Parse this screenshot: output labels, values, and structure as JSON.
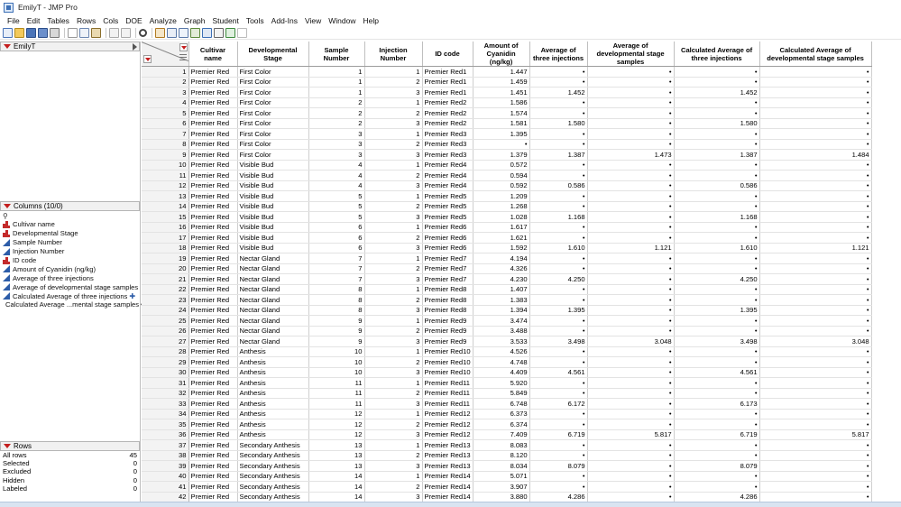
{
  "window": {
    "title": "EmilyT - JMP Pro"
  },
  "menu": [
    "File",
    "Edit",
    "Tables",
    "Rows",
    "Cols",
    "DOE",
    "Analyze",
    "Graph",
    "Student",
    "Tools",
    "Add-Ins",
    "View",
    "Window",
    "Help"
  ],
  "table_panel": {
    "name": "EmilyT"
  },
  "columns_panel": {
    "header": "Columns (10/0)",
    "items": [
      {
        "label": "Cultivar name",
        "type": "nominal"
      },
      {
        "label": "Developmental Stage",
        "type": "nominal"
      },
      {
        "label": "Sample Number",
        "type": "continuous"
      },
      {
        "label": "Injection Number",
        "type": "continuous"
      },
      {
        "label": "ID code",
        "type": "nominal"
      },
      {
        "label": "Amount of Cyanidin (ng/kg)",
        "type": "continuous"
      },
      {
        "label": "Average of three injections",
        "type": "continuous"
      },
      {
        "label": "Average of developmental stage samples",
        "type": "continuous"
      },
      {
        "label": "Calculated Average of three injections",
        "type": "continuous",
        "badge": "plus"
      },
      {
        "label": "Calculated Average ...mental stage samples",
        "type": "continuous",
        "badge": "dot"
      }
    ]
  },
  "rows_panel": {
    "header": "Rows",
    "items": [
      {
        "label": "All rows",
        "value": "45"
      },
      {
        "label": "Selected",
        "value": "0"
      },
      {
        "label": "Excluded",
        "value": "0"
      },
      {
        "label": "Hidden",
        "value": "0"
      },
      {
        "label": "Labeled",
        "value": "0"
      }
    ]
  },
  "grid": {
    "columns": [
      "Cultivar name",
      "Developmental Stage",
      "Sample Number",
      "Injection Number",
      "ID code",
      "Amount of Cyanidin (ng/kg)",
      "Average of three injections",
      "Average of developmental stage samples",
      "Calculated Average of three injections",
      "Calculated Average of developmental stage samples"
    ],
    "rows": [
      [
        "1",
        "Premier Red",
        "First Color",
        "1",
        "1",
        "Premier Red1",
        "1.447",
        "•",
        "•",
        "•",
        "•"
      ],
      [
        "2",
        "Premier Red",
        "First Color",
        "1",
        "2",
        "Premier Red1",
        "1.459",
        "•",
        "•",
        "•",
        "•"
      ],
      [
        "3",
        "Premier Red",
        "First Color",
        "1",
        "3",
        "Premier Red1",
        "1.451",
        "1.452",
        "•",
        "1.452",
        "•"
      ],
      [
        "4",
        "Premier Red",
        "First Color",
        "2",
        "1",
        "Premier Red2",
        "1.586",
        "•",
        "•",
        "•",
        "•"
      ],
      [
        "5",
        "Premier Red",
        "First Color",
        "2",
        "2",
        "Premier Red2",
        "1.574",
        "•",
        "•",
        "•",
        "•"
      ],
      [
        "6",
        "Premier Red",
        "First Color",
        "2",
        "3",
        "Premier Red2",
        "1.581",
        "1.580",
        "•",
        "1.580",
        "•"
      ],
      [
        "7",
        "Premier Red",
        "First Color",
        "3",
        "1",
        "Premier Red3",
        "1.395",
        "•",
        "•",
        "•",
        "•"
      ],
      [
        "8",
        "Premier Red",
        "First Color",
        "3",
        "2",
        "Premier Red3",
        "•",
        "•",
        "•",
        "•",
        "•"
      ],
      [
        "9",
        "Premier Red",
        "First Color",
        "3",
        "3",
        "Premier Red3",
        "1.379",
        "1.387",
        "1.473",
        "1.387",
        "1.484"
      ],
      [
        "10",
        "Premier Red",
        "Visible Bud",
        "4",
        "1",
        "Premier Red4",
        "0.572",
        "•",
        "•",
        "•",
        "•"
      ],
      [
        "11",
        "Premier Red",
        "Visible Bud",
        "4",
        "2",
        "Premier Red4",
        "0.594",
        "•",
        "•",
        "•",
        "•"
      ],
      [
        "12",
        "Premier Red",
        "Visible Bud",
        "4",
        "3",
        "Premier Red4",
        "0.592",
        "0.586",
        "•",
        "0.586",
        "•"
      ],
      [
        "13",
        "Premier Red",
        "Visible Bud",
        "5",
        "1",
        "Premier Red5",
        "1.209",
        "•",
        "•",
        "•",
        "•"
      ],
      [
        "14",
        "Premier Red",
        "Visible Bud",
        "5",
        "2",
        "Premier Red5",
        "1.268",
        "•",
        "•",
        "•",
        "•"
      ],
      [
        "15",
        "Premier Red",
        "Visible Bud",
        "5",
        "3",
        "Premier Red5",
        "1.028",
        "1.168",
        "•",
        "1.168",
        "•"
      ],
      [
        "16",
        "Premier Red",
        "Visible Bud",
        "6",
        "1",
        "Premier Red6",
        "1.617",
        "•",
        "•",
        "•",
        "•"
      ],
      [
        "17",
        "Premier Red",
        "Visible Bud",
        "6",
        "2",
        "Premier Red6",
        "1.621",
        "•",
        "•",
        "•",
        "•"
      ],
      [
        "18",
        "Premier Red",
        "Visible Bud",
        "6",
        "3",
        "Premier Red6",
        "1.592",
        "1.610",
        "1.121",
        "1.610",
        "1.121"
      ],
      [
        "19",
        "Premier Red",
        "Nectar Gland",
        "7",
        "1",
        "Premier Red7",
        "4.194",
        "•",
        "•",
        "•",
        "•"
      ],
      [
        "20",
        "Premier Red",
        "Nectar Gland",
        "7",
        "2",
        "Premier Red7",
        "4.326",
        "•",
        "•",
        "•",
        "•"
      ],
      [
        "21",
        "Premier Red",
        "Nectar Gland",
        "7",
        "3",
        "Premier Red7",
        "4.230",
        "4.250",
        "•",
        "4.250",
        "•"
      ],
      [
        "22",
        "Premier Red",
        "Nectar Gland",
        "8",
        "1",
        "Premier Red8",
        "1.407",
        "•",
        "•",
        "•",
        "•"
      ],
      [
        "23",
        "Premier Red",
        "Nectar Gland",
        "8",
        "2",
        "Premier Red8",
        "1.383",
        "•",
        "•",
        "•",
        "•"
      ],
      [
        "24",
        "Premier Red",
        "Nectar Gland",
        "8",
        "3",
        "Premier Red8",
        "1.394",
        "1.395",
        "•",
        "1.395",
        "•"
      ],
      [
        "25",
        "Premier Red",
        "Nectar Gland",
        "9",
        "1",
        "Premier Red9",
        "3.474",
        "•",
        "•",
        "•",
        "•"
      ],
      [
        "26",
        "Premier Red",
        "Nectar Gland",
        "9",
        "2",
        "Premier Red9",
        "3.488",
        "•",
        "•",
        "•",
        "•"
      ],
      [
        "27",
        "Premier Red",
        "Nectar Gland",
        "9",
        "3",
        "Premier Red9",
        "3.533",
        "3.498",
        "3.048",
        "3.498",
        "3.048"
      ],
      [
        "28",
        "Premier Red",
        "Anthesis",
        "10",
        "1",
        "Premier Red10",
        "4.526",
        "•",
        "•",
        "•",
        "•"
      ],
      [
        "29",
        "Premier Red",
        "Anthesis",
        "10",
        "2",
        "Premier Red10",
        "4.748",
        "•",
        "•",
        "•",
        "•"
      ],
      [
        "30",
        "Premier Red",
        "Anthesis",
        "10",
        "3",
        "Premier Red10",
        "4.409",
        "4.561",
        "•",
        "4.561",
        "•"
      ],
      [
        "31",
        "Premier Red",
        "Anthesis",
        "11",
        "1",
        "Premier Red11",
        "5.920",
        "•",
        "•",
        "•",
        "•"
      ],
      [
        "32",
        "Premier Red",
        "Anthesis",
        "11",
        "2",
        "Premier Red11",
        "5.849",
        "•",
        "•",
        "•",
        "•"
      ],
      [
        "33",
        "Premier Red",
        "Anthesis",
        "11",
        "3",
        "Premier Red11",
        "6.748",
        "6.172",
        "•",
        "6.173",
        "•"
      ],
      [
        "34",
        "Premier Red",
        "Anthesis",
        "12",
        "1",
        "Premier Red12",
        "6.373",
        "•",
        "•",
        "•",
        "•"
      ],
      [
        "35",
        "Premier Red",
        "Anthesis",
        "12",
        "2",
        "Premier Red12",
        "6.374",
        "•",
        "•",
        "•",
        "•"
      ],
      [
        "36",
        "Premier Red",
        "Anthesis",
        "12",
        "3",
        "Premier Red12",
        "7.409",
        "6.719",
        "5.817",
        "6.719",
        "5.817"
      ],
      [
        "37",
        "Premier Red",
        "Secondary Anthesis",
        "13",
        "1",
        "Premier Red13",
        "8.083",
        "•",
        "•",
        "•",
        "•"
      ],
      [
        "38",
        "Premier Red",
        "Secondary Anthesis",
        "13",
        "2",
        "Premier Red13",
        "8.120",
        "•",
        "•",
        "•",
        "•"
      ],
      [
        "39",
        "Premier Red",
        "Secondary Anthesis",
        "13",
        "3",
        "Premier Red13",
        "8.034",
        "8.079",
        "•",
        "8.079",
        "•"
      ],
      [
        "40",
        "Premier Red",
        "Secondary Anthesis",
        "14",
        "1",
        "Premier Red14",
        "5.071",
        "•",
        "•",
        "•",
        "•"
      ],
      [
        "41",
        "Premier Red",
        "Secondary Anthesis",
        "14",
        "2",
        "Premier Red14",
        "3.907",
        "•",
        "•",
        "•",
        "•"
      ],
      [
        "42",
        "Premier Red",
        "Secondary Anthesis",
        "14",
        "3",
        "Premier Red14",
        "3.880",
        "4.286",
        "•",
        "4.286",
        "•"
      ]
    ]
  },
  "colors": {
    "accent_red": "#c41e1e",
    "continuous_blue": "#2c5ca8"
  },
  "toolbar_icons": [
    "new-table-icon",
    "open-icon",
    "save-icon",
    "save-all-icon",
    "print-icon",
    "cut-icon",
    "copy-icon",
    "paste-icon",
    "undo-icon",
    "redo-icon",
    "search-icon",
    "data-table-icon",
    "journal-icon",
    "report-icon",
    "graph-builder-icon",
    "distribution-icon",
    "fit-model-icon",
    "script-icon",
    "pen-icon"
  ]
}
